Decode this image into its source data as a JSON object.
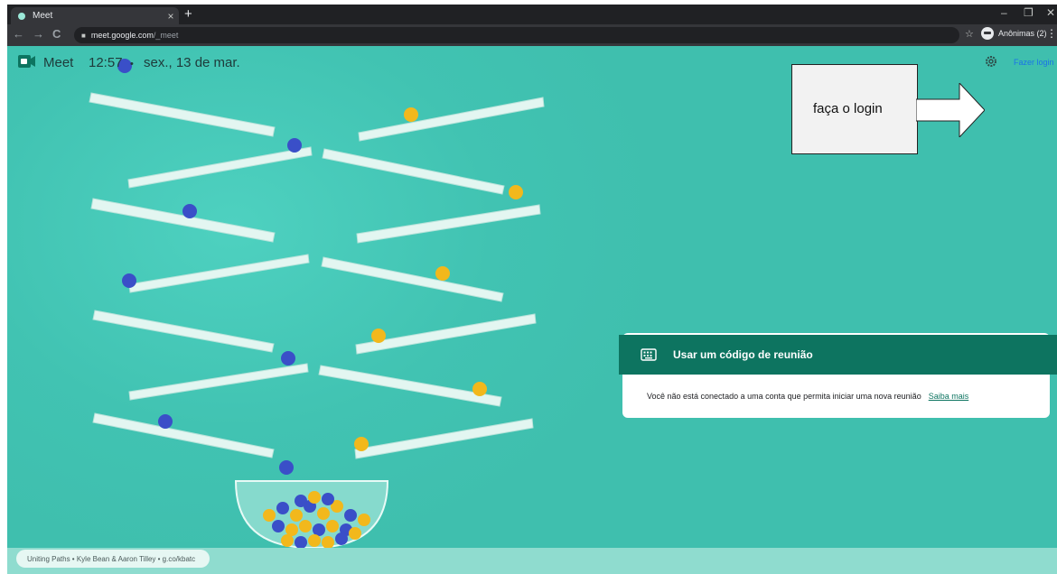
{
  "tab": {
    "title": "Meet",
    "close_glyph": "×",
    "new_glyph": "+"
  },
  "window": {
    "minimize": "–",
    "restore": "❐",
    "close": "✕"
  },
  "toolbar": {
    "back_glyph": "←",
    "forward_glyph": "→",
    "reload_glyph": "C",
    "url_host": "meet.google.com",
    "url_path": "/_meet",
    "star_glyph": "☆",
    "profile_label": "Anônimas (2)",
    "menu_glyph": "⋮"
  },
  "header": {
    "app_name": "Meet",
    "time": "12:57",
    "date": "sex., 13 de mar.",
    "login_label": "Fazer login"
  },
  "callout": {
    "text": "faça o login"
  },
  "card": {
    "title": "Usar um código de reunião",
    "message": "Você não está conectado a uma conta que permita iniciar uma nova reunião",
    "link": "Saiba mais"
  },
  "attribution": "Uniting Paths  •  Kyle Bean & Aaron Tilley  •  g.co/kbatc",
  "colors": {
    "background": "#3fbfae",
    "card_header": "#0d7460",
    "marble_blue": "#3a4fc8",
    "marble_yellow": "#f2b81c",
    "login_link": "#1a73e8"
  },
  "icons": [
    "meet-logo-icon",
    "gear-icon",
    "keyboard-icon",
    "lock-icon",
    "star-icon",
    "incognito-icon"
  ]
}
